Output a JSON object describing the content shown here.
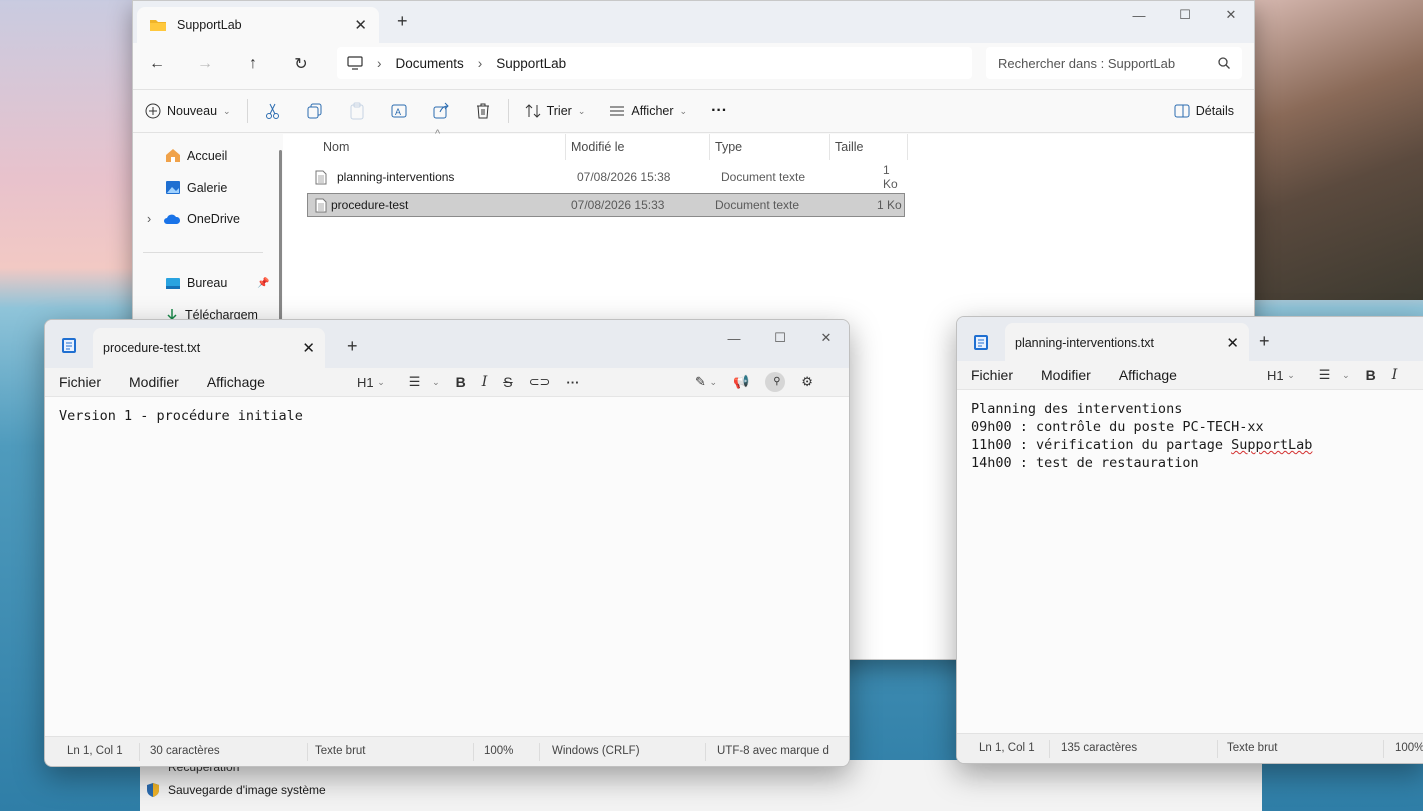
{
  "explorer": {
    "tab_title": "SupportLab",
    "new_tab": "+",
    "close": "✕",
    "breadcrumb": [
      "Documents",
      "SupportLab"
    ],
    "search_placeholder": "Rechercher dans : SupportLab",
    "toolbar": {
      "new": "Nouveau",
      "sort": "Trier",
      "view": "Afficher",
      "more": "···",
      "details": "Détails"
    },
    "sidebar": {
      "home": "Accueil",
      "gallery": "Galerie",
      "onedrive": "OneDrive",
      "desktop": "Bureau",
      "downloads": "Téléchargem",
      "recovery": "Récupération",
      "system_image": "Sauvegarde d'image système"
    },
    "columns": {
      "name": "Nom",
      "modified": "Modifié le",
      "type": "Type",
      "size": "Taille"
    },
    "files": [
      {
        "name": "planning-interventions",
        "modified": "07/08/2026 15:38",
        "type": "Document texte",
        "size": "1 Ko"
      },
      {
        "name": "procedure-test",
        "modified": "07/08/2026 15:33",
        "type": "Document texte",
        "size": "1 Ko"
      }
    ]
  },
  "notepad_left": {
    "tab_title": "procedure-test.txt",
    "menu": [
      "Fichier",
      "Modifier",
      "Affichage"
    ],
    "heading": "H1",
    "content": "Version 1 - procédure initiale",
    "status": {
      "position": "Ln 1, Col 1",
      "chars": "30 caractères",
      "format": "Texte brut",
      "zoom": "100%",
      "eol": "Windows (CRLF)",
      "encoding": "UTF-8 avec marque d"
    }
  },
  "notepad_right": {
    "tab_title": "planning-interventions.txt",
    "menu": [
      "Fichier",
      "Modifier",
      "Affichage"
    ],
    "heading": "H1",
    "lines": [
      "Planning des interventions",
      "09h00 : contrôle du poste PC-TECH-xx",
      "11h00 : vérification du partage ",
      "SupportLab",
      "14h00 : test de restauration"
    ],
    "status": {
      "position": "Ln 1, Col 1",
      "chars": "135 caractères",
      "format": "Texte brut",
      "zoom": "100%"
    }
  },
  "colors": {
    "accent": "#0067c0",
    "folder": "#f0b429"
  }
}
